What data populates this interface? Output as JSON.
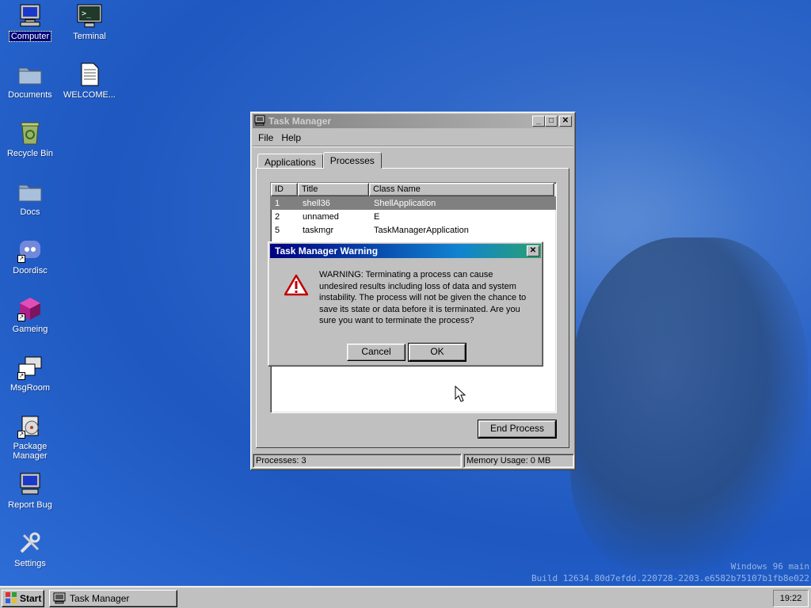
{
  "desktop": {
    "icons": [
      {
        "label": "Computer",
        "icon": "computer-icon"
      },
      {
        "label": "Terminal",
        "icon": "terminal-icon"
      },
      {
        "label": "Documents",
        "icon": "folder-icon"
      },
      {
        "label": "WELCOME...",
        "icon": "text-file-icon"
      },
      {
        "label": "Recycle Bin",
        "icon": "recycle-bin-icon"
      },
      {
        "label": "Docs",
        "icon": "folder-icon"
      },
      {
        "label": "Doordisc",
        "icon": "doordisc-icon"
      },
      {
        "label": "Gameing",
        "icon": "cube-icon"
      },
      {
        "label": "MsgRoom",
        "icon": "chat-icon"
      },
      {
        "label": "Package\nManager",
        "icon": "package-icon"
      },
      {
        "label": "Report Bug",
        "icon": "monitor-bug-icon"
      },
      {
        "label": "Settings",
        "icon": "tools-icon"
      }
    ],
    "watermark_line1": "Windows 96 main",
    "watermark_line2": "Build 12634.80d7efdd.220728-2203.e6582b75107b1fb8e022"
  },
  "task_manager": {
    "title": "Task Manager",
    "menu": [
      "File",
      "Help"
    ],
    "tabs": [
      "Applications",
      "Processes"
    ],
    "active_tab": "Processes",
    "columns": [
      "ID",
      "Title",
      "Class Name"
    ],
    "rows": [
      {
        "id": "1",
        "title": "shell36",
        "class": "ShellApplication"
      },
      {
        "id": "2",
        "title": "unnamed",
        "class": "E"
      },
      {
        "id": "5",
        "title": "taskmgr",
        "class": "TaskManagerApplication"
      }
    ],
    "end_process_label": "End Process",
    "status_processes": "Processes: 3",
    "status_memory": "Memory Usage: 0 MB"
  },
  "warning_dialog": {
    "title": "Task Manager Warning",
    "message": "WARNING: Terminating a process can cause undesired results including loss of data and system instability. The process will not be given the chance to save its state or data before it is terminated. Are you sure you want to terminate the process?",
    "cancel_label": "Cancel",
    "ok_label": "OK"
  },
  "taskbar": {
    "start_label": "Start",
    "task_label": "Task Manager",
    "clock": "19:22"
  }
}
